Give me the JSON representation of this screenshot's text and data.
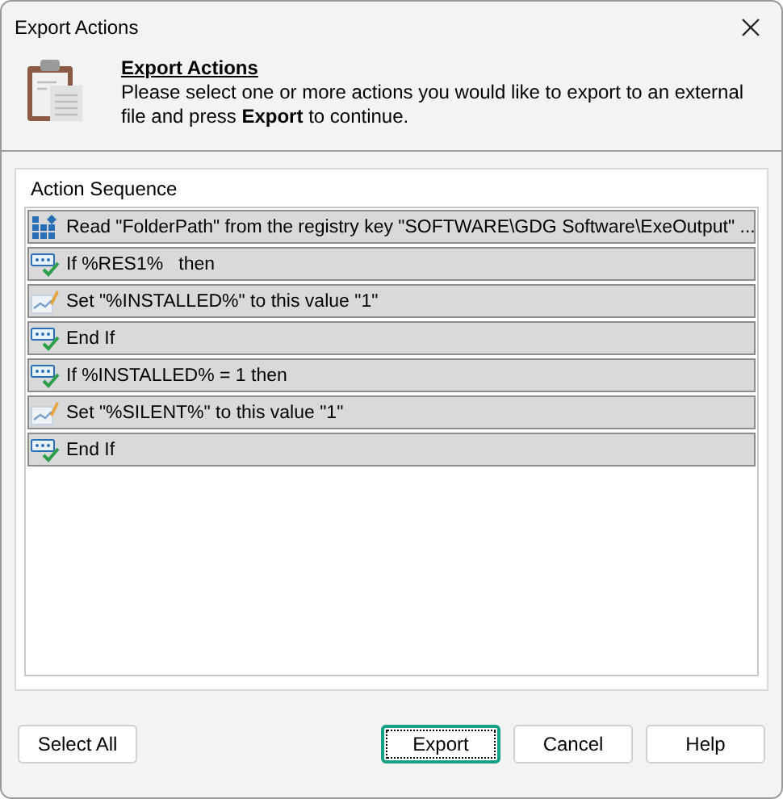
{
  "window": {
    "title": "Export Actions"
  },
  "header": {
    "title": "Export Actions",
    "text": "Please select one or more actions you would like to export to an external file and press **Export** to continue."
  },
  "list": {
    "heading": "Action Sequence",
    "rows": [
      {
        "kind": "registry",
        "label": "Read \"FolderPath\" from the registry key \"SOFTWARE\\GDG Software\\ExeOutput\" ...",
        "selected": true
      },
      {
        "kind": "condition",
        "label": "If %RES1%   then",
        "selected": true
      },
      {
        "kind": "set",
        "label": "Set \"%INSTALLED%\" to this value \"1\"",
        "selected": true
      },
      {
        "kind": "condition",
        "label": "End If",
        "selected": true
      },
      {
        "kind": "condition",
        "label": "If %INSTALLED% = 1 then",
        "selected": true
      },
      {
        "kind": "set",
        "label": "Set \"%SILENT%\" to this value \"1\"",
        "selected": true
      },
      {
        "kind": "condition",
        "label": "End If",
        "selected": true
      }
    ]
  },
  "buttons": [
    {
      "label": "Select All",
      "focused": false
    },
    {
      "label": "Export",
      "focused": true
    },
    {
      "label": "Cancel",
      "focused": false
    },
    {
      "label": "Help",
      "focused": false
    }
  ]
}
